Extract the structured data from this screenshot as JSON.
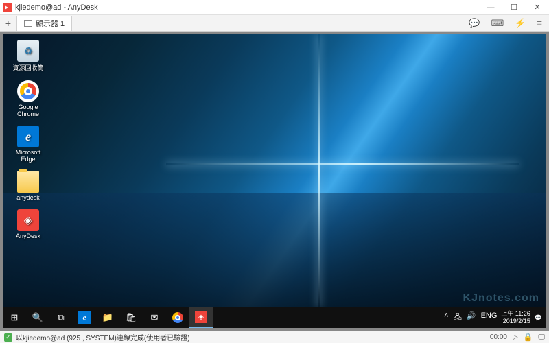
{
  "titlebar": {
    "title": "kjiedemo@ad - AnyDesk"
  },
  "tabs": {
    "new": "+",
    "tab1": "顯示器 1"
  },
  "toolbar": {
    "chat": "💬",
    "keyboard": "⌨",
    "actions": "⚡",
    "menu": "≡"
  },
  "win": {
    "min": "—",
    "max": "☐",
    "close": "✕"
  },
  "desktop": {
    "recycle": "資源回收筒",
    "chrome": "Google Chrome",
    "edge": "Microsoft Edge",
    "folder": "anydesk",
    "anydesk": "AnyDesk"
  },
  "taskbar": {
    "start": "⊞",
    "search": "🔍",
    "taskview": "⧉",
    "explorer": "📁",
    "store": "🛍",
    "mail": "✉"
  },
  "tray": {
    "up": "˄",
    "net": "🖧",
    "vol": "🔊",
    "lang": "ENG",
    "time": "上午 11:26",
    "date": "2019/2/15",
    "notif": "💬"
  },
  "watermark": "KJnotes.com",
  "status": {
    "text": "以kjiedemo@ad (925        , SYSTEM)連線完成(使用者已驗證)",
    "timer": "00:00",
    "lock": "🔒"
  }
}
